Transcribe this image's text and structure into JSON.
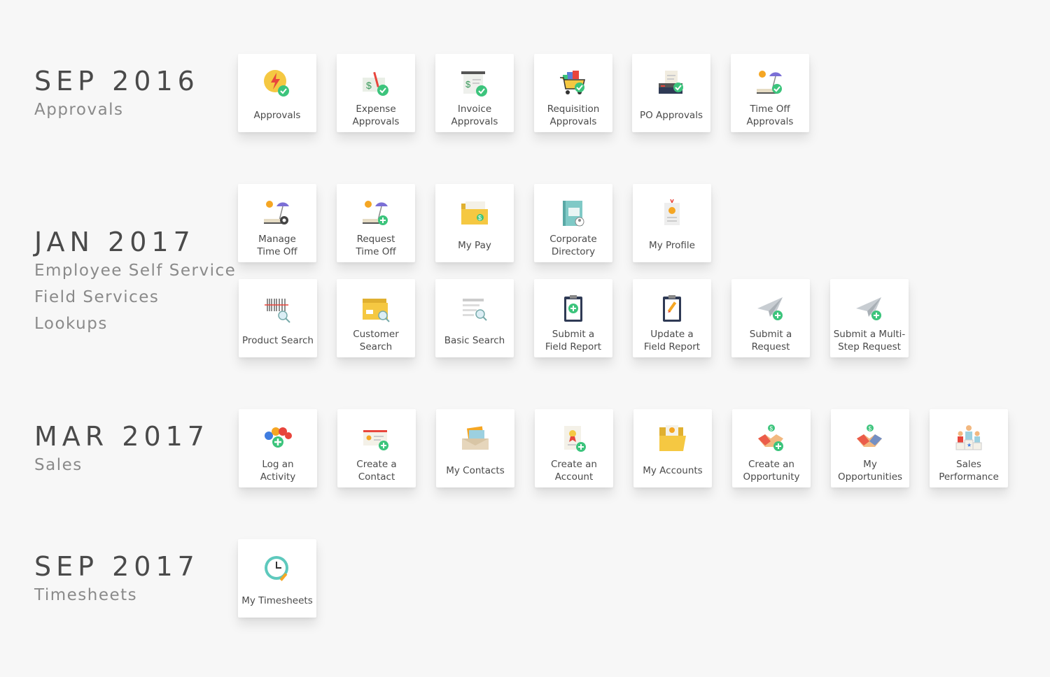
{
  "sections": [
    {
      "date": "SEP 2016",
      "categories": [
        "Approvals"
      ]
    },
    {
      "date": "JAN 2017",
      "categories": [
        "Employee Self Service",
        "Field Services",
        "Lookups"
      ]
    },
    {
      "date": "MAR 2017",
      "categories": [
        "Sales"
      ]
    },
    {
      "date": "SEP 2017",
      "categories": [
        "Timesheets"
      ]
    }
  ],
  "tiles": {
    "approvals": "Approvals",
    "expense_approvals": "Expense\nApprovals",
    "invoice_approvals": "Invoice\nApprovals",
    "requisition_approvals": "Requisition\nApprovals",
    "po_approvals": "PO Approvals",
    "time_off_approvals": "Time Off\nApprovals",
    "manage_time_off": "Manage\nTime Off",
    "request_time_off": "Request\nTime Off",
    "my_pay": "My Pay",
    "corporate_directory": "Corporate\nDirectory",
    "my_profile": "My Profile",
    "product_search": "Product Search",
    "customer_search": "Customer\nSearch",
    "basic_search": "Basic Search",
    "submit_field_report": "Submit a\nField Report",
    "update_field_report": "Update a\nField Report",
    "submit_request": "Submit a\nRequest",
    "submit_multi_step_request": "Submit a Multi-\nStep Request",
    "log_activity": "Log an\nActivity",
    "create_contact": "Create a\nContact",
    "my_contacts": "My Contacts",
    "create_account": "Create an\nAccount",
    "my_accounts": "My Accounts",
    "create_opportunity": "Create an\nOpportunity",
    "my_opportunities": "My\nOpportunities",
    "sales_performance": "Sales\nPerformance",
    "my_timesheets": "My Timesheets"
  },
  "colors": {
    "accent_green": "#3cc47c",
    "folder_yellow": "#f5c842",
    "text_dark": "#4a4a4a",
    "text_muted": "#8a8a8a"
  }
}
